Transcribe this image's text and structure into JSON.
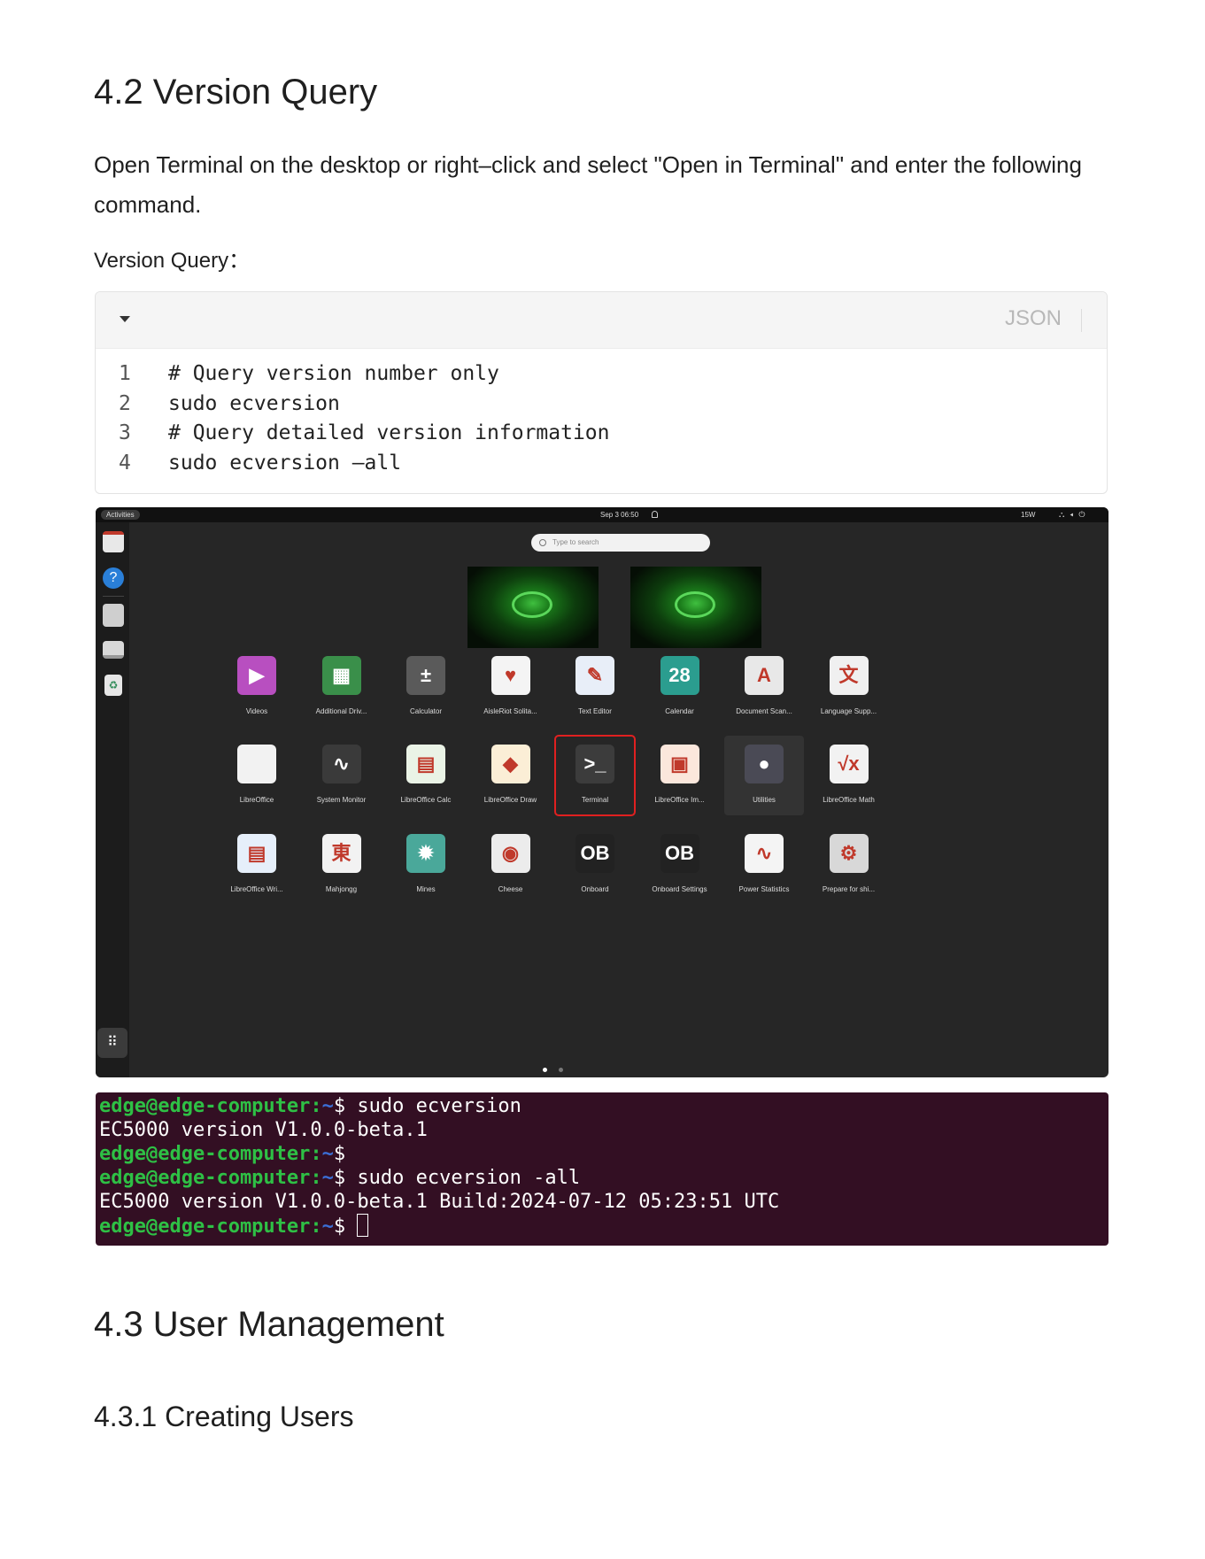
{
  "section_4_2": {
    "title": "4.2 Version Query",
    "intro": "Open Terminal on the desktop or right–click and select \"Open in Terminal\" and enter the following command.",
    "label": "Version Query："
  },
  "code": {
    "language": "JSON",
    "lines": [
      {
        "num": "1",
        "text": "# Query version number only"
      },
      {
        "num": "2",
        "text": "sudo ecversion"
      },
      {
        "num": "3",
        "text": "# Query detailed version information"
      },
      {
        "num": "4",
        "text": "sudo ecversion –all"
      }
    ]
  },
  "desktop": {
    "activities": "Activities",
    "clock": "Sep 3  06:50",
    "power": "15W",
    "search_placeholder": "Type to search",
    "apps_row1": [
      "Videos",
      "Additional Driv...",
      "Calculator",
      "AisleRiot Solita...",
      "Text Editor",
      "Calendar",
      "Document Scan...",
      "Language Supp..."
    ],
    "apps_row2": [
      "LibreOffice",
      "System Monitor",
      "LibreOffice Calc",
      "LibreOffice Draw",
      "Terminal",
      "LibreOffice Im...",
      "Utilities",
      "LibreOffice Math"
    ],
    "apps_row3": [
      "LibreOffice Wri...",
      "Mahjongg",
      "Mines",
      "Cheese",
      "Onboard",
      "Onboard Settings",
      "Power Statistics",
      "Prepare for shi..."
    ],
    "calendar_day": "28",
    "selected_app": "Terminal"
  },
  "terminal": {
    "user": "edge@edge-computer",
    "path": "~",
    "lines": [
      {
        "prompt": true,
        "cmd": " sudo ecversion"
      },
      {
        "prompt": false,
        "text": "EC5000 version V1.0.0-beta.1"
      },
      {
        "prompt": true,
        "cmd": ""
      },
      {
        "prompt": true,
        "cmd": " sudo ecversion -all"
      },
      {
        "prompt": false,
        "text": "EC5000 version V1.0.0-beta.1 Build:2024-07-12 05:23:51 UTC"
      },
      {
        "prompt": true,
        "cmd": " ",
        "cursor": true
      }
    ]
  },
  "section_4_3": {
    "title": "4.3 User Management",
    "sub_title": "4.3.1 Creating Users"
  }
}
